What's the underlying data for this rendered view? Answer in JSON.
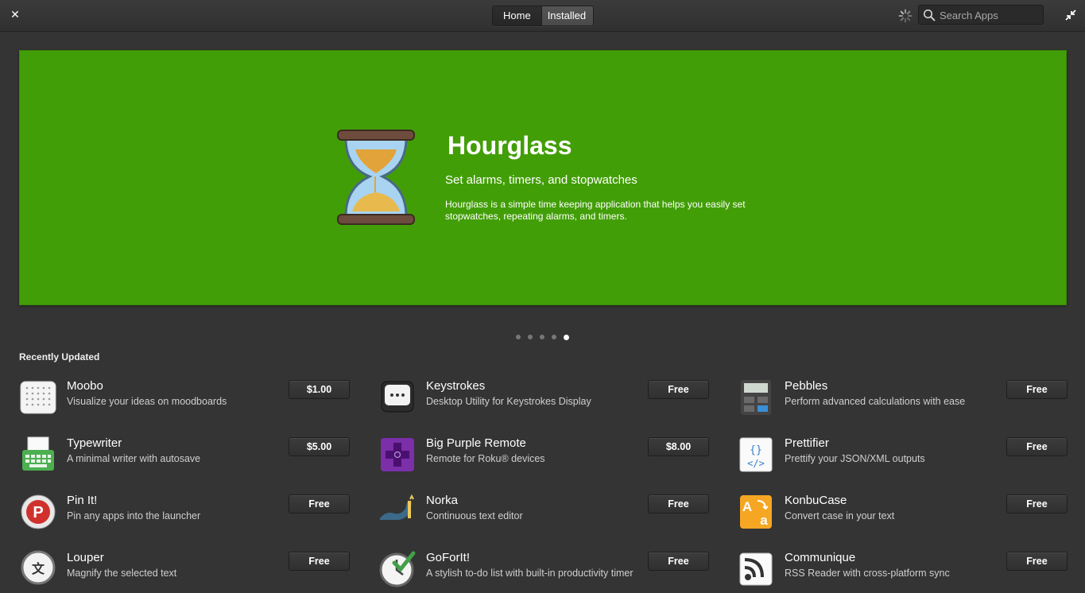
{
  "header": {
    "tabs": [
      {
        "label": "Home"
      },
      {
        "label": "Installed"
      }
    ],
    "search_placeholder": "Search Apps"
  },
  "banner": {
    "title": "Hourglass",
    "subtitle": "Set alarms, timers, and stopwatches",
    "description": "Hourglass is a simple time keeping application that helps you easily set stopwatches, repeating alarms, and timers.",
    "color": "#429e07",
    "page_count": 5,
    "active_page": 5
  },
  "recently_updated": {
    "title": "Recently Updated",
    "apps": [
      {
        "name": "Moobo",
        "summary": "Visualize your ideas on moodboards",
        "price": "$1.00",
        "icon": "moobo-icon"
      },
      {
        "name": "Keystrokes",
        "summary": "Desktop Utility for Keystrokes Display",
        "price": "Free",
        "icon": "keystrokes-icon"
      },
      {
        "name": "Pebbles",
        "summary": "Perform advanced calculations with ease",
        "price": "Free",
        "icon": "pebbles-calculator-icon"
      },
      {
        "name": "Typewriter",
        "summary": "A minimal writer with autosave",
        "price": "$5.00",
        "icon": "typewriter-icon"
      },
      {
        "name": "Big Purple Remote",
        "summary": "Remote for Roku® devices",
        "price": "$8.00",
        "icon": "remote-dpad-icon"
      },
      {
        "name": "Prettifier",
        "summary": "Prettify your JSON/XML outputs",
        "price": "Free",
        "icon": "prettifier-code-icon"
      },
      {
        "name": "Pin It!",
        "summary": "Pin any apps into the launcher",
        "price": "Free",
        "icon": "pin-it-icon"
      },
      {
        "name": "Norka",
        "summary": "Continuous text editor",
        "price": "Free",
        "icon": "norka-icon"
      },
      {
        "name": "KonbuCase",
        "summary": "Convert case in your text",
        "price": "Free",
        "icon": "konbucase-icon"
      },
      {
        "name": "Louper",
        "summary": "Magnify the selected text",
        "price": "Free",
        "icon": "louper-magnifier-icon"
      },
      {
        "name": "GoForIt!",
        "summary": "A stylish to-do list with built-in productivity timer",
        "price": "Free",
        "icon": "goforit-clock-icon"
      },
      {
        "name": "Communique",
        "summary": "RSS Reader with cross-platform sync",
        "price": "Free",
        "icon": "rss-feed-icon"
      }
    ]
  }
}
